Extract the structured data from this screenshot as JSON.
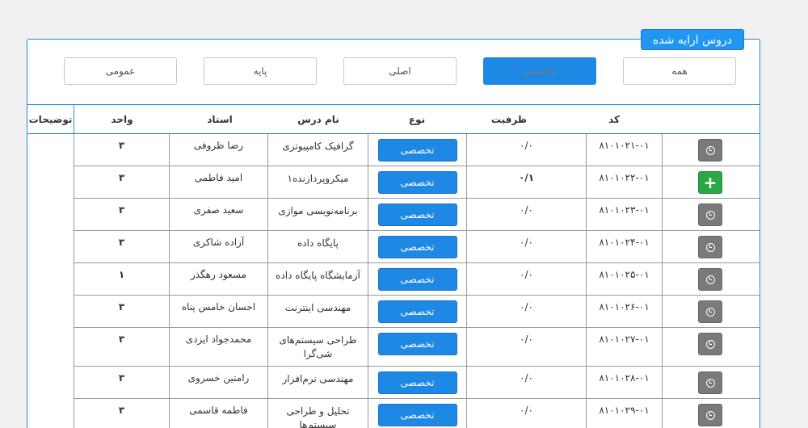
{
  "panel": {
    "title": "دروس ارایه شده"
  },
  "filters": [
    {
      "label": "همه",
      "active": false
    },
    {
      "label": "تخصصی",
      "active": true
    },
    {
      "label": "اصلی",
      "active": false
    },
    {
      "label": "پایه",
      "active": false
    },
    {
      "label": "عمومی",
      "active": false
    }
  ],
  "headers": {
    "code": "کد",
    "capacity": "ظرفیت",
    "type": "نوع",
    "name": "نام درس",
    "teacher": "استاد",
    "unit": "واحد",
    "desc": "توضیحات"
  },
  "rows": [
    {
      "action": "clock-icon",
      "code": "۸۱۰۱۰۲۱-۰۱",
      "capacity": "۰/۰",
      "type": "تخصصی",
      "name": "گرافیک کامپیوتری",
      "teacher": "رضا ظروفی",
      "unit": "۳"
    },
    {
      "action": "plus-icon",
      "code": "۸۱۰۱۰۲۲-۰۱",
      "capacity": "۰/۱",
      "type": "تخصصی",
      "name": "میکروپردازنده۱",
      "teacher": "امید فاطمی",
      "unit": "۳"
    },
    {
      "action": "clock-icon",
      "code": "۸۱۰۱۰۲۳-۰۱",
      "capacity": "۰/۰",
      "type": "تخصصی",
      "name": "برنامه‌نویسی موازی",
      "teacher": "سعید صفری",
      "unit": "۳"
    },
    {
      "action": "clock-icon",
      "code": "۸۱۰۱۰۲۴-۰۱",
      "capacity": "۰/۰",
      "type": "تخصصی",
      "name": "پایگاه داده",
      "teacher": "آزاده شاکری",
      "unit": "۳"
    },
    {
      "action": "clock-icon",
      "code": "۸۱۰۱۰۲۵-۰۱",
      "capacity": "۰/۰",
      "type": "تخصصی",
      "name": "آزمایشگاه پایگاه داده",
      "teacher": "مسعود رهگذر",
      "unit": "۱"
    },
    {
      "action": "clock-icon",
      "code": "۸۱۰۱۰۲۶-۰۱",
      "capacity": "۰/۰",
      "type": "تخصصی",
      "name": "مهندسی اینترنت",
      "teacher": "احسان خامس پناه",
      "unit": "۳"
    },
    {
      "action": "clock-icon",
      "code": "۸۱۰۱۰۲۷-۰۱",
      "capacity": "۰/۰",
      "type": "تخصصی",
      "name": "طراحی سیستم‌های شی‌گرا",
      "teacher": "محمدجواد ایزدی",
      "unit": "۳"
    },
    {
      "action": "clock-icon",
      "code": "۸۱۰۱۰۲۸-۰۱",
      "capacity": "۰/۰",
      "type": "تخصصی",
      "name": "مهندسی نرم‌افزار",
      "teacher": "رامتین خسروی",
      "unit": "۳"
    },
    {
      "action": "clock-icon",
      "code": "۸۱۰۱۰۲۹-۰۱",
      "capacity": "۰/۰",
      "type": "تخصصی",
      "name": "تحلیل و طراحی سیستم‌ها",
      "teacher": "فاطمه قاسمی",
      "unit": "۳"
    }
  ]
}
